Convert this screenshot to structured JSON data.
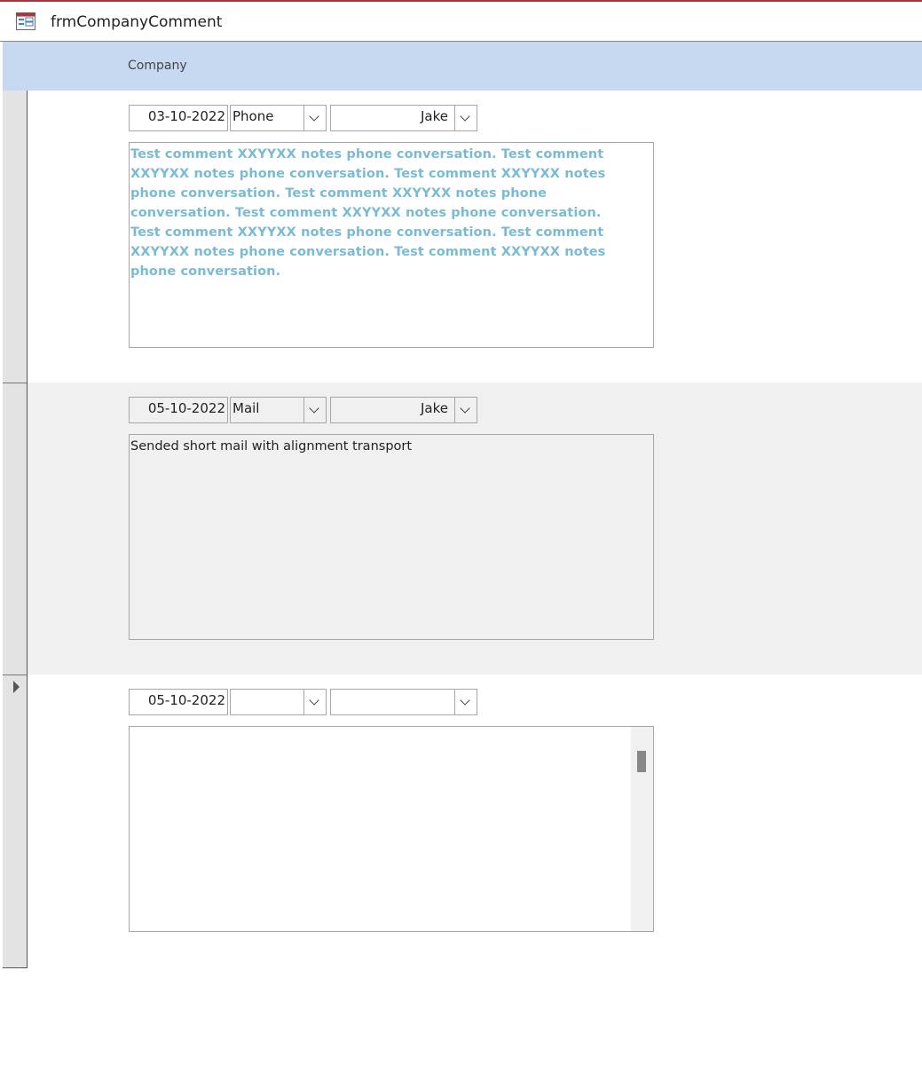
{
  "window": {
    "title": "frmCompanyComment"
  },
  "header": {
    "label": "Company"
  },
  "records": [
    {
      "date": "03-10-2022",
      "type": "Phone",
      "user": "Jake",
      "comment": "Test comment XXYYXX notes phone conversation. Test comment XXYYXX notes phone conversation. Test comment XXYYXX notes phone conversation. Test comment XXYYXX notes phone conversation. Test comment XXYYXX notes phone conversation. Test comment XXYYXX notes phone conversation. Test comment XXYYXX notes phone conversation. Test comment XXYYXX notes phone conversation."
    },
    {
      "date": "05-10-2022",
      "type": "Mail",
      "user": "Jake",
      "comment": "Sended short mail with alignment transport"
    },
    {
      "date": "05-10-2022",
      "type": "",
      "user": "",
      "comment": ""
    }
  ],
  "icons": {
    "form_icon": "form-icon",
    "dropdown": "chevron-down-icon",
    "current_record": "record-pointer-icon"
  },
  "colors": {
    "accent_border": "#a4373a",
    "header_bg": "#c6d9f0",
    "highlight_text": "#7abbd3",
    "alt_row_bg": "#f0f0f0"
  }
}
